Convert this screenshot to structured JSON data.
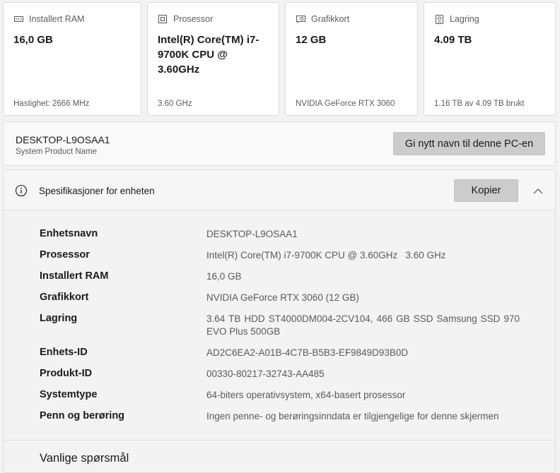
{
  "cards": [
    {
      "icon": "ram-icon",
      "label": "Installert RAM",
      "value": "16,0 GB",
      "footer": "Hastighet: 2666 MHz"
    },
    {
      "icon": "processor-icon",
      "label": "Prosessor",
      "value": "Intel(R) Core(TM) i7-9700K CPU @ 3.60GHz",
      "footer": "3.60 GHz"
    },
    {
      "icon": "graphics-card-icon",
      "label": "Grafikkort",
      "value": "12 GB",
      "footer": "NVIDIA GeForce RTX 3060"
    },
    {
      "icon": "storage-icon",
      "label": "Lagring",
      "value": "4.09 TB",
      "footer": "1.16 TB av 4.09 TB brukt"
    }
  ],
  "device": {
    "name": "DESKTOP-L9OSAA1",
    "subtitle": "System Product Name",
    "rename_label": "Gi nytt navn til denne PC-en"
  },
  "specs": {
    "title": "Spesifikasjoner for enheten",
    "copy_label": "Kopier",
    "icons": {
      "info": "info-icon",
      "collapse": "chevron-up-icon"
    },
    "rows": [
      {
        "key": "Enhetsnavn",
        "value": "DESKTOP-L9OSAA1"
      },
      {
        "key": "Prosessor",
        "value": "Intel(R) Core(TM) i7-9700K CPU @ 3.60GHz   3.60 GHz"
      },
      {
        "key": "Installert RAM",
        "value": "16,0 GB"
      },
      {
        "key": "Grafikkort",
        "value": "NVIDIA GeForce RTX 3060 (12 GB)"
      },
      {
        "key": "Lagring",
        "value": "3.64 TB HDD ST4000DM004-2CV104, 466 GB SSD Samsung SSD 970 EVO Plus 500GB"
      },
      {
        "key": "Enhets-ID",
        "value": "AD2C6EA2-A01B-4C7B-B5B3-EF9849D93B0D"
      },
      {
        "key": "Produkt-ID",
        "value": "00330-80217-32743-AA485"
      },
      {
        "key": "Systemtype",
        "value": "64-biters operativsystem, x64-basert prosessor"
      },
      {
        "key": "Penn og berøring",
        "value": "Ingen penne- og berøringsinndata er tilgjengelige for denne skjermen"
      }
    ]
  },
  "faq": {
    "title": "Vanlige spørsmål"
  }
}
